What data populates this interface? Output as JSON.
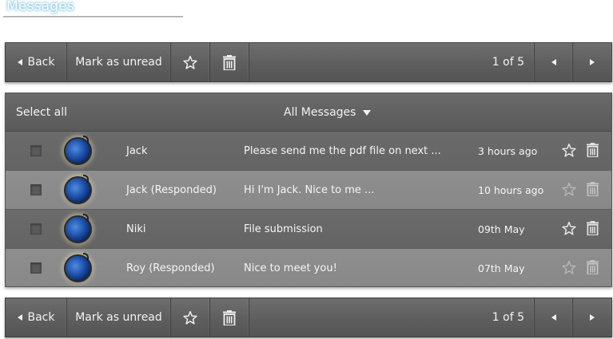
{
  "page": {
    "title": "Messages"
  },
  "toolbar": {
    "back_label": "Back",
    "mark_unread_label": "Mark as unread",
    "star_icon": "star-icon",
    "trash_icon": "trash-icon",
    "pagination": "1 of 5"
  },
  "list": {
    "select_all_label": "Select all",
    "filter_label": "All Messages",
    "messages": [
      {
        "sender": "Jack",
        "subject": "Please send me the pdf file on next ...",
        "time": "3 hours ago"
      },
      {
        "sender": "Jack (Responded)",
        "subject": "Hi I'm Jack. Nice to me ...",
        "time": "10 hours ago"
      },
      {
        "sender": "Niki",
        "subject": "File submission",
        "time": "09th May"
      },
      {
        "sender": "Roy (Responded)",
        "subject": "Nice to meet you!",
        "time": "07th May"
      }
    ]
  },
  "colors": {
    "toolbar_bg": "#5f5f5f",
    "row_dark": "#676767",
    "row_light": "#8b8b8b",
    "title_glow": "#7fc6e8"
  }
}
